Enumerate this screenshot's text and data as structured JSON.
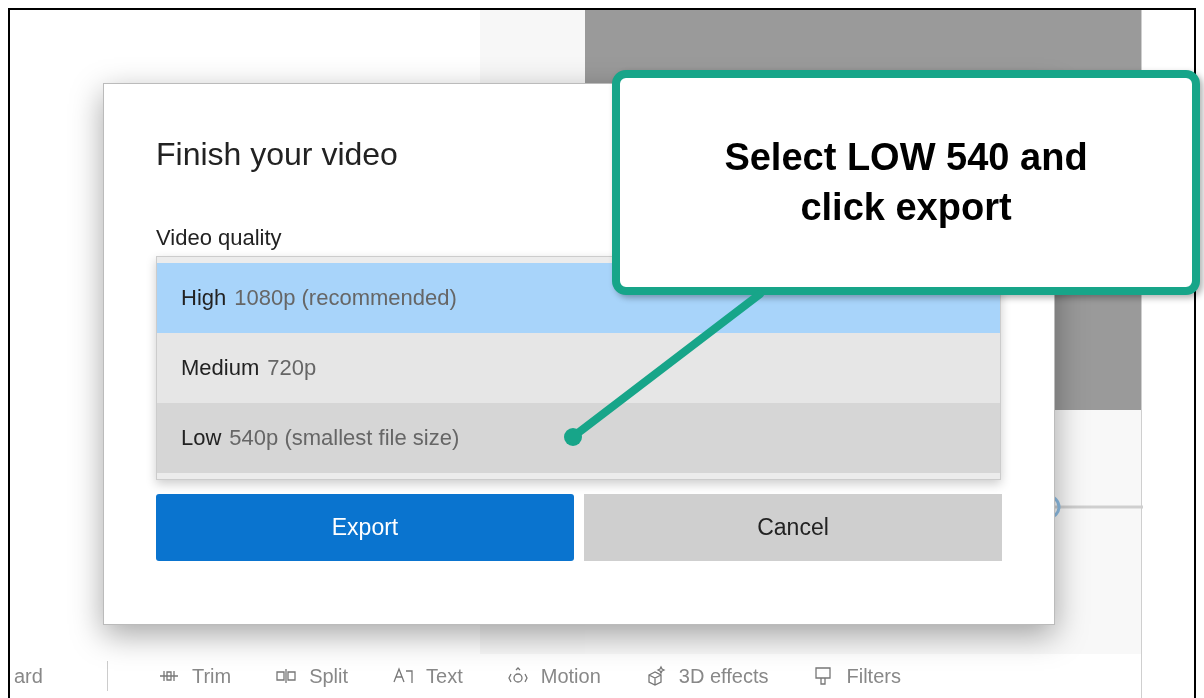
{
  "toolbar": {
    "cut_item": "ard",
    "items": [
      {
        "kind": "trim",
        "label": "Trim"
      },
      {
        "kind": "split",
        "label": "Split"
      },
      {
        "kind": "text",
        "label": "Text"
      },
      {
        "kind": "motion",
        "label": "Motion"
      },
      {
        "kind": "effects",
        "label": "3D effects"
      },
      {
        "kind": "filters",
        "label": "Filters"
      }
    ]
  },
  "dialog": {
    "title": "Finish your video",
    "quality_label": "Video quality",
    "options": [
      {
        "name": "High",
        "detail": "1080p (recommended)",
        "selected": true,
        "hovered": false
      },
      {
        "name": "Medium",
        "detail": "720p",
        "selected": false,
        "hovered": false
      },
      {
        "name": "Low",
        "detail": "540p (smallest file size)",
        "selected": false,
        "hovered": true
      }
    ],
    "buttons": [
      {
        "kind": "primary",
        "label": "Export"
      },
      {
        "kind": "secondary",
        "label": "Cancel"
      }
    ]
  },
  "callout": {
    "text": "Select LOW 540 and click export"
  }
}
